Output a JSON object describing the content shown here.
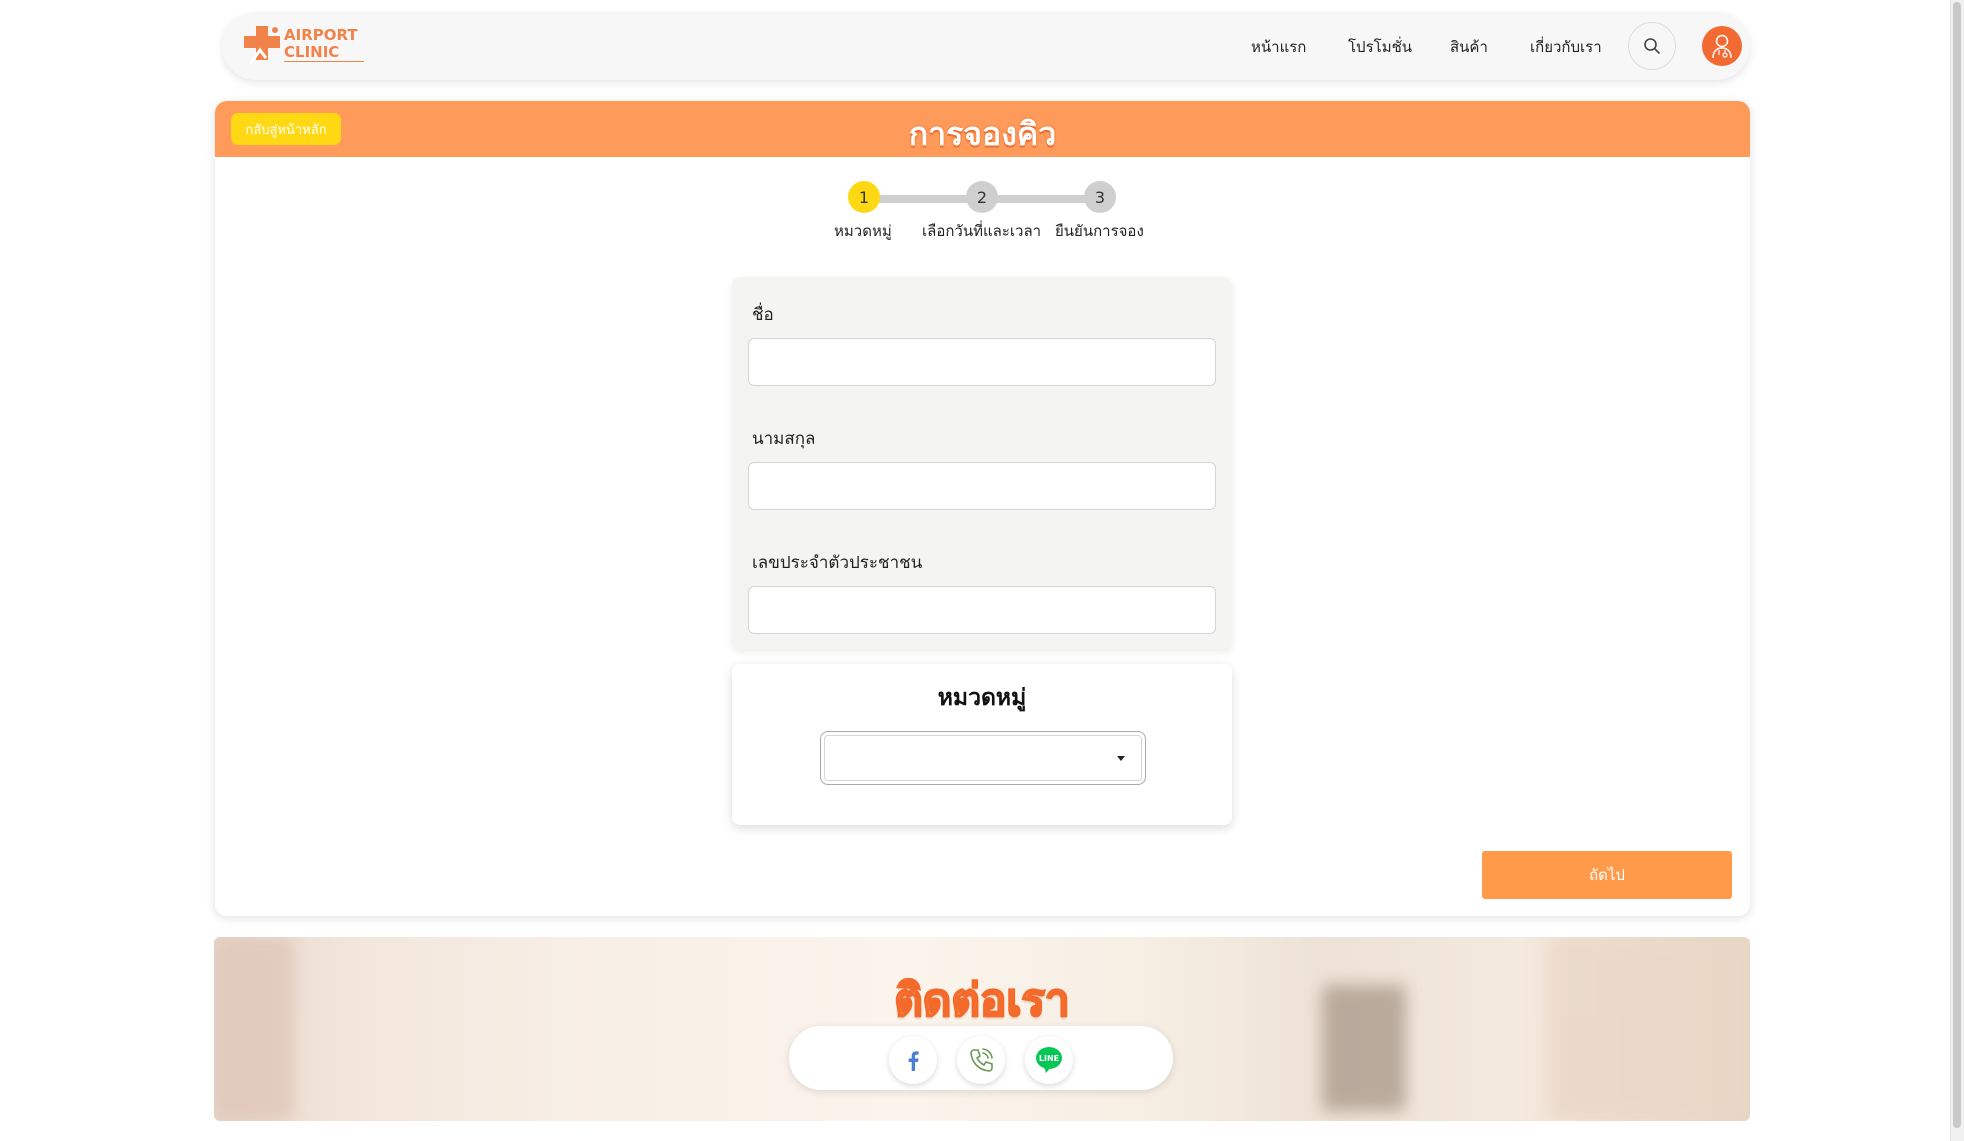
{
  "header": {
    "logo": {
      "line1": "AIRPORT",
      "line2": "CLINIC"
    },
    "nav": [
      {
        "label": "หน้าแรก"
      },
      {
        "label": "โปรโมชั่น"
      },
      {
        "label": "สินค้า"
      },
      {
        "label": "เกี่ยวกับเรา"
      }
    ],
    "search_icon": "search-icon",
    "avatar_icon": "doctor-avatar-icon"
  },
  "banner": {
    "back_label": "กลับสู่หน้าหลัก",
    "title": "การจองคิว"
  },
  "stepper": {
    "steps": [
      {
        "number": "1",
        "label": "หมวดหมู่",
        "active": true
      },
      {
        "number": "2",
        "label": "เลือกวันที่และเวลา",
        "active": false
      },
      {
        "number": "3",
        "label": "ยืนยันการจอง",
        "active": false
      }
    ]
  },
  "form": {
    "first_name": {
      "label": "ชื่อ",
      "value": ""
    },
    "last_name": {
      "label": "นามสกุล",
      "value": ""
    },
    "national_id": {
      "label": "เลขประจำตัวประชาชน",
      "value": ""
    }
  },
  "category": {
    "title": "หมวดหมู่",
    "selected": ""
  },
  "next_label": "ถัดไป",
  "contact": {
    "title": "ติดต่อเรา",
    "icons": [
      "facebook-icon",
      "phone-icon",
      "line-icon"
    ],
    "line_text": "LINE"
  },
  "colors": {
    "primary_orange": "#fe9a5a",
    "accent_yellow": "#ffd814",
    "avatar_orange": "#f26a32",
    "facebook_blue": "#4a7fd4",
    "line_green": "#06c755"
  }
}
